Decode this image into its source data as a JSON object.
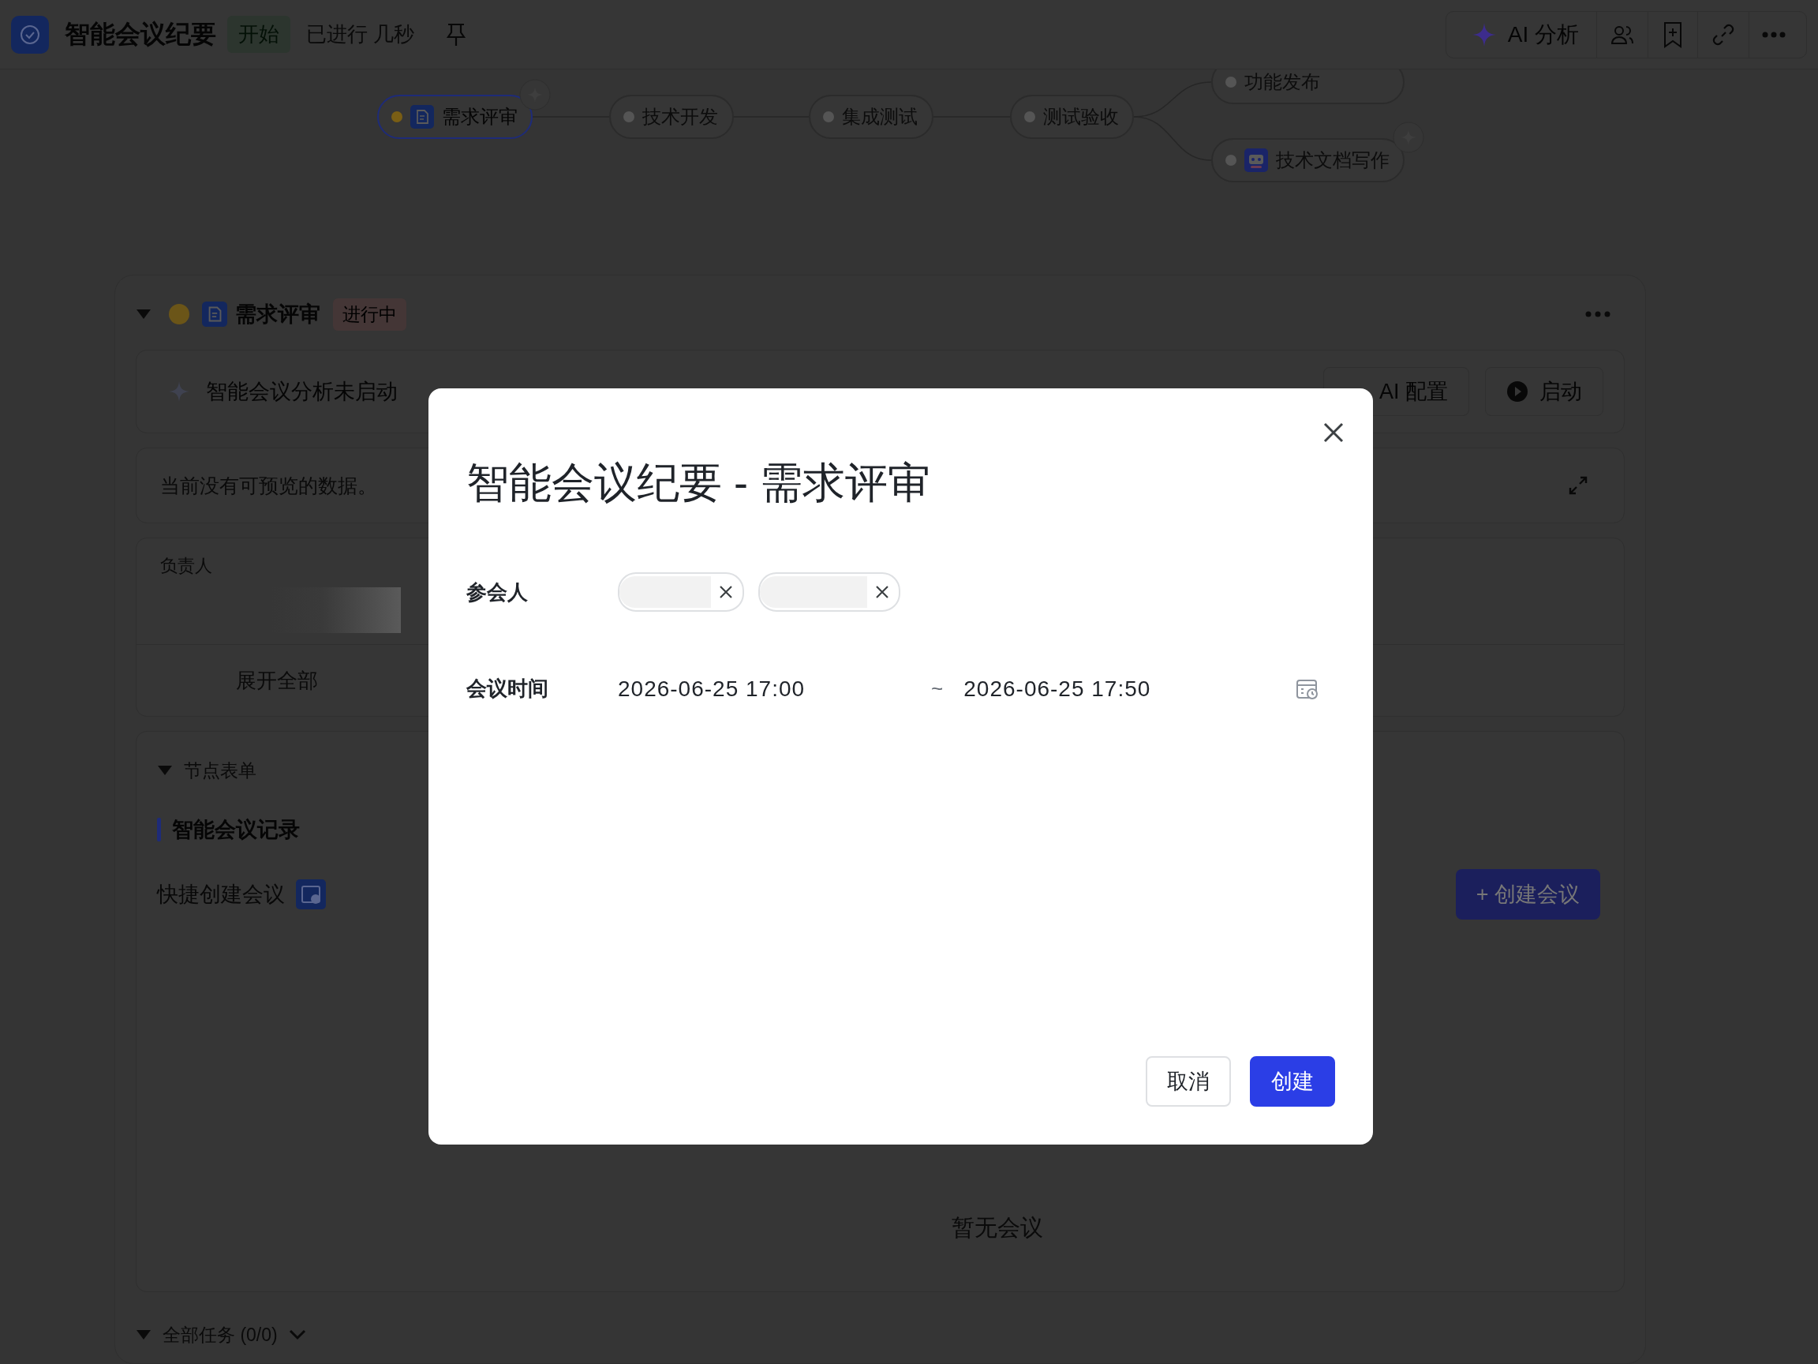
{
  "header": {
    "title": "智能会议纪要",
    "status": "开始",
    "elapsed": "已进行 几秒",
    "actions": [
      {
        "kind": "ai",
        "label": "AI 分析"
      },
      {
        "kind": "members"
      },
      {
        "kind": "bookmark"
      },
      {
        "kind": "link"
      },
      {
        "kind": "more"
      }
    ]
  },
  "flow": {
    "nodes": [
      {
        "label": "需求评审",
        "selected": true,
        "color": "#7a5e14",
        "kind": "doc"
      },
      {
        "label": "技术开发",
        "selected": false,
        "color": "#555555",
        "kind": "plain"
      },
      {
        "label": "集成测试",
        "selected": false,
        "color": "#555555",
        "kind": "plain"
      },
      {
        "label": "测试验收",
        "selected": false,
        "color": "#555555",
        "kind": "plain"
      },
      {
        "label": "功能发布",
        "selected": false,
        "color": "#555555",
        "kind": "plain"
      },
      {
        "label": "技术文档写作",
        "selected": false,
        "color": "#555555",
        "kind": "ai"
      }
    ]
  },
  "section": {
    "title": "需求评审",
    "status": "进行中",
    "expanded": true,
    "ai_card": {
      "text": "智能会议分析未启动",
      "buttons": [
        {
          "kind": "config",
          "label": "AI 配置"
        },
        {
          "kind": "start",
          "label": "启动"
        }
      ]
    },
    "preview": "当前没有可预览的数据。",
    "owner_label": "负责人",
    "expand_all": "展开全部",
    "form": {
      "title": "节点表单",
      "expanded": true,
      "record_title": "智能会议记录",
      "quick_create": "快捷创建会议",
      "create_button": "+ 创建会议",
      "empty": "暂无会议"
    },
    "tasks": {
      "label": "全部任务 (0/0)",
      "expanded": true
    }
  },
  "modal": {
    "title": "智能会议纪要 - 需求评审",
    "attendees_label": "参会人",
    "attendees": [
      {
        "kind": "redacted"
      },
      {
        "kind": "redacted"
      }
    ],
    "time_label": "会议时间",
    "start": "2026-06-25 17:00",
    "separator": "~",
    "end": "2026-06-25 17:50",
    "buttons": [
      {
        "kind": "secondary",
        "label": "取消"
      },
      {
        "kind": "primary",
        "label": "创建"
      }
    ]
  }
}
